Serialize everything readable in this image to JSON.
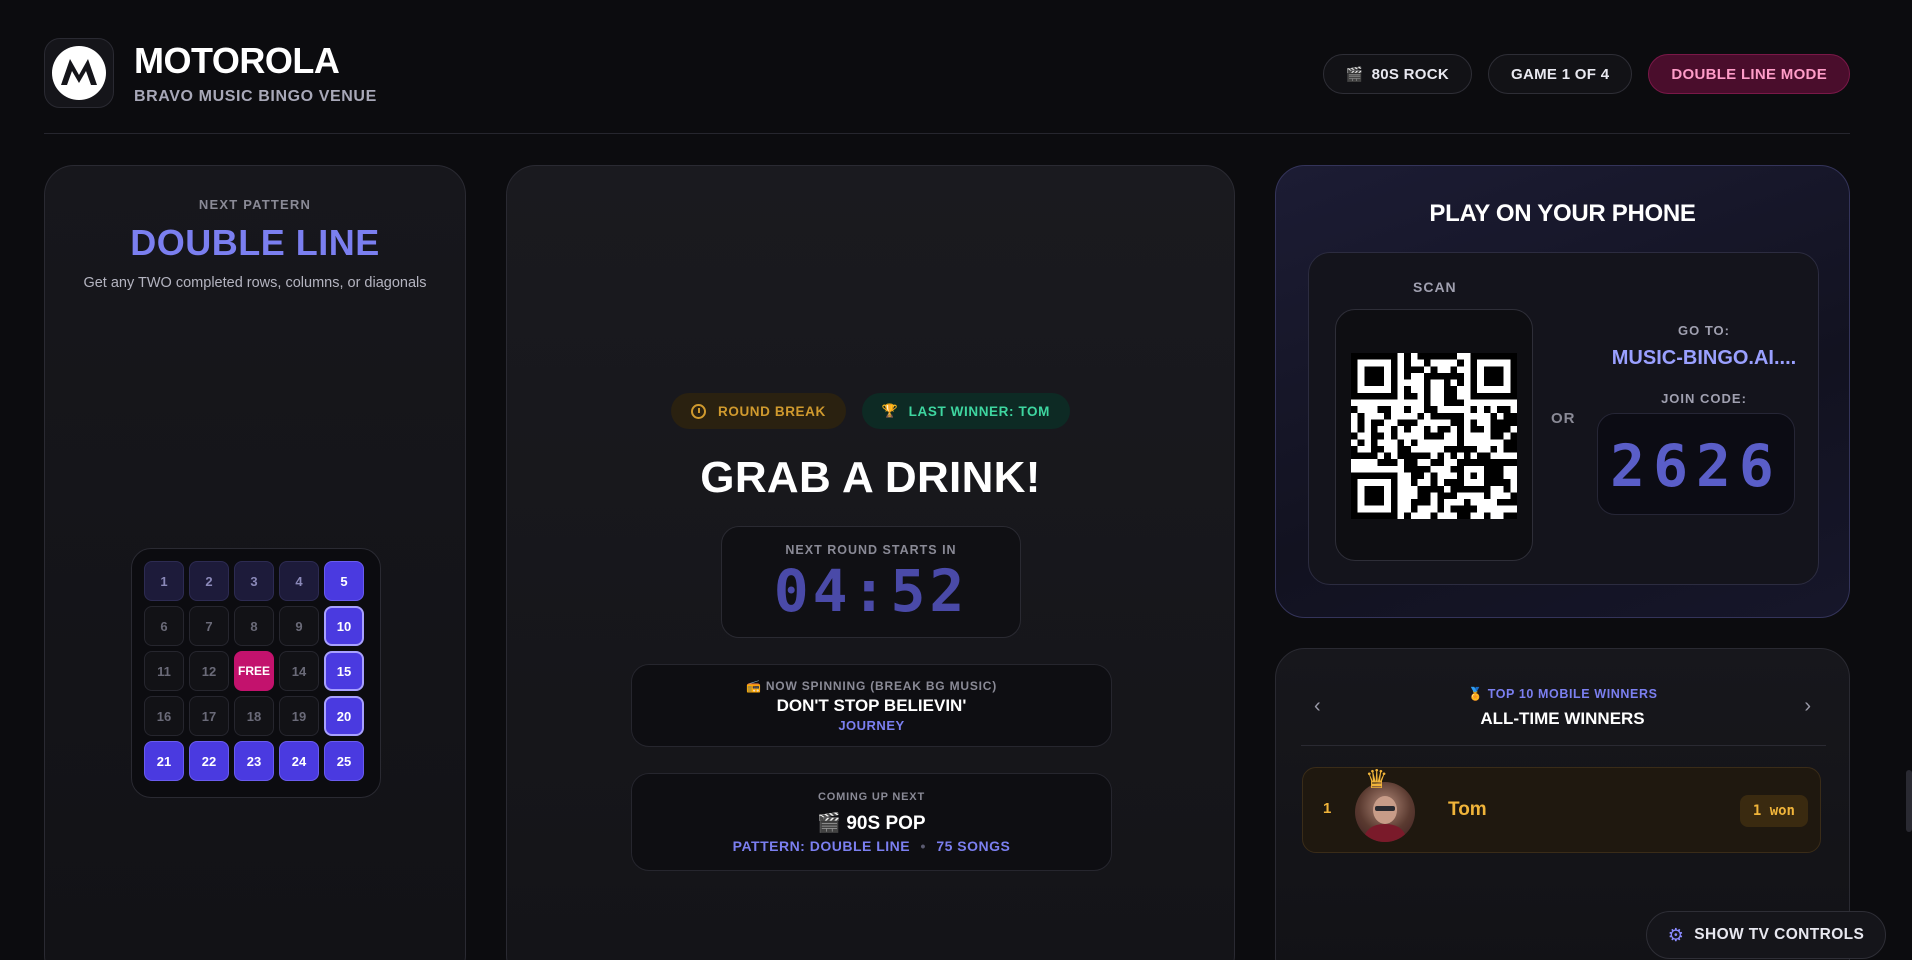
{
  "header": {
    "brand_title": "MOTOROLA",
    "brand_subtitle": "BRAVO MUSIC BINGO VENUE",
    "pills": [
      {
        "icon": "clapperboard-icon",
        "emoji": "🎬",
        "label": "80S ROCK"
      },
      {
        "label": "GAME 1 OF 4"
      },
      {
        "label": "DOUBLE LINE MODE"
      }
    ]
  },
  "left_panel": {
    "label": "NEXT PATTERN",
    "title": "DOUBLE LINE",
    "description": "Get any TWO completed rows, columns, or diagonals",
    "cells": [
      {
        "text": "1",
        "state": "dim"
      },
      {
        "text": "2",
        "state": "dim"
      },
      {
        "text": "3",
        "state": "dim"
      },
      {
        "text": "4",
        "state": "dim"
      },
      {
        "text": "5",
        "state": "on"
      },
      {
        "text": "6",
        "state": "off"
      },
      {
        "text": "7",
        "state": "off"
      },
      {
        "text": "8",
        "state": "off"
      },
      {
        "text": "9",
        "state": "off"
      },
      {
        "text": "10",
        "state": "on-outline"
      },
      {
        "text": "11",
        "state": "off"
      },
      {
        "text": "12",
        "state": "off"
      },
      {
        "text": "FREE",
        "state": "free"
      },
      {
        "text": "14",
        "state": "off"
      },
      {
        "text": "15",
        "state": "on-outline"
      },
      {
        "text": "16",
        "state": "off"
      },
      {
        "text": "17",
        "state": "off"
      },
      {
        "text": "18",
        "state": "off"
      },
      {
        "text": "19",
        "state": "off"
      },
      {
        "text": "20",
        "state": "on-outline"
      },
      {
        "text": "21",
        "state": "on"
      },
      {
        "text": "22",
        "state": "on"
      },
      {
        "text": "23",
        "state": "on"
      },
      {
        "text": "24",
        "state": "on"
      },
      {
        "text": "25",
        "state": "on"
      }
    ]
  },
  "center_panel": {
    "badge_break": "ROUND BREAK",
    "badge_winner": "LAST WINNER: TOM",
    "badge_winner_emoji": "🏆",
    "title": "GRAB A DRINK!",
    "timer_label": "NEXT ROUND STARTS IN",
    "timer_value": "04:52",
    "now_spinning": {
      "emoji": "📻",
      "label": "NOW SPINNING (BREAK BG MUSIC)",
      "song": "DON'T STOP BELIEVIN'",
      "artist": "JOURNEY"
    },
    "coming_up": {
      "label": "COMING UP NEXT",
      "emoji": "🎬",
      "playlist": "90S POP",
      "pattern": "PATTERN: DOUBLE LINE",
      "separator": "•",
      "songs": "75 SONGS"
    }
  },
  "join_panel": {
    "title": "PLAY ON YOUR PHONE",
    "scan_label": "SCAN",
    "or_label": "OR",
    "goto_label": "GO TO:",
    "url": "MUSIC-BINGO.AI....",
    "join_label": "JOIN CODE:",
    "join_code": "2626"
  },
  "winners_panel": {
    "label": "TOP 10 MOBILE WINNERS",
    "label_emoji": "🏅",
    "title": "ALL-TIME WINNERS",
    "prev_icon": "‹",
    "next_icon": "›",
    "rows": [
      {
        "rank": "1",
        "name": "Tom",
        "count": "1 won"
      }
    ]
  },
  "tv_controls": {
    "label": "SHOW TV CONTROLS",
    "icon": "gear-icon"
  },
  "colors": {
    "accent": "#7b7ff0",
    "free": "#c3126d",
    "gold": "#f0b43a",
    "mode_pill": "#4a0d2c"
  }
}
